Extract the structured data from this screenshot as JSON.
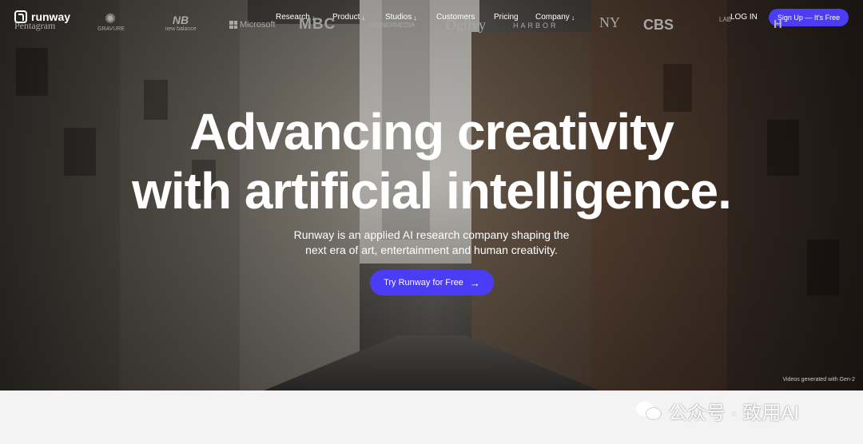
{
  "nav": {
    "logo_text": "runway",
    "menu": [
      {
        "label": "Research",
        "arrow": "↓"
      },
      {
        "label": "Product",
        "arrow": "↓"
      },
      {
        "label": "Studios",
        "arrow": "↓"
      },
      {
        "label": "Customers",
        "arrow": ""
      },
      {
        "label": "Pricing",
        "arrow": ""
      },
      {
        "label": "Company",
        "arrow": "↓"
      }
    ],
    "login_label": "LOG IN",
    "signup_label": "Sign Up — It's Free"
  },
  "hero": {
    "headline_line1": "Advancing creativity",
    "headline_line2": "with artificial intelligence.",
    "subtitle_line1": "Runway is an applied AI research company shaping the",
    "subtitle_line2": "next era of art, entertainment and human creativity.",
    "cta_label": "Try Runway for Free",
    "cta_arrow": "→",
    "credit": "Videos generated with Gen-2"
  },
  "brands": {
    "pentagram": "Pentagram",
    "gravure_icon": "✺",
    "gravure": "GRAVURE",
    "nb_mark": "NB",
    "nb": "new balance",
    "microsoft": "Microsoft",
    "mbc": "MBC",
    "vayner": "VAYNERMEDIA",
    "ogilvy": "Ogilvy",
    "harbor": "HARBOR",
    "ny": "NY",
    "cbs": "CBS",
    "lab": "LAB",
    "h": "H"
  },
  "watermark": {
    "text": "公众号 · 致用AI"
  },
  "colors": {
    "accent": "#4a3df5",
    "strip_bg": "#f3f3f3",
    "brand_gray": "#a8a8a8"
  }
}
